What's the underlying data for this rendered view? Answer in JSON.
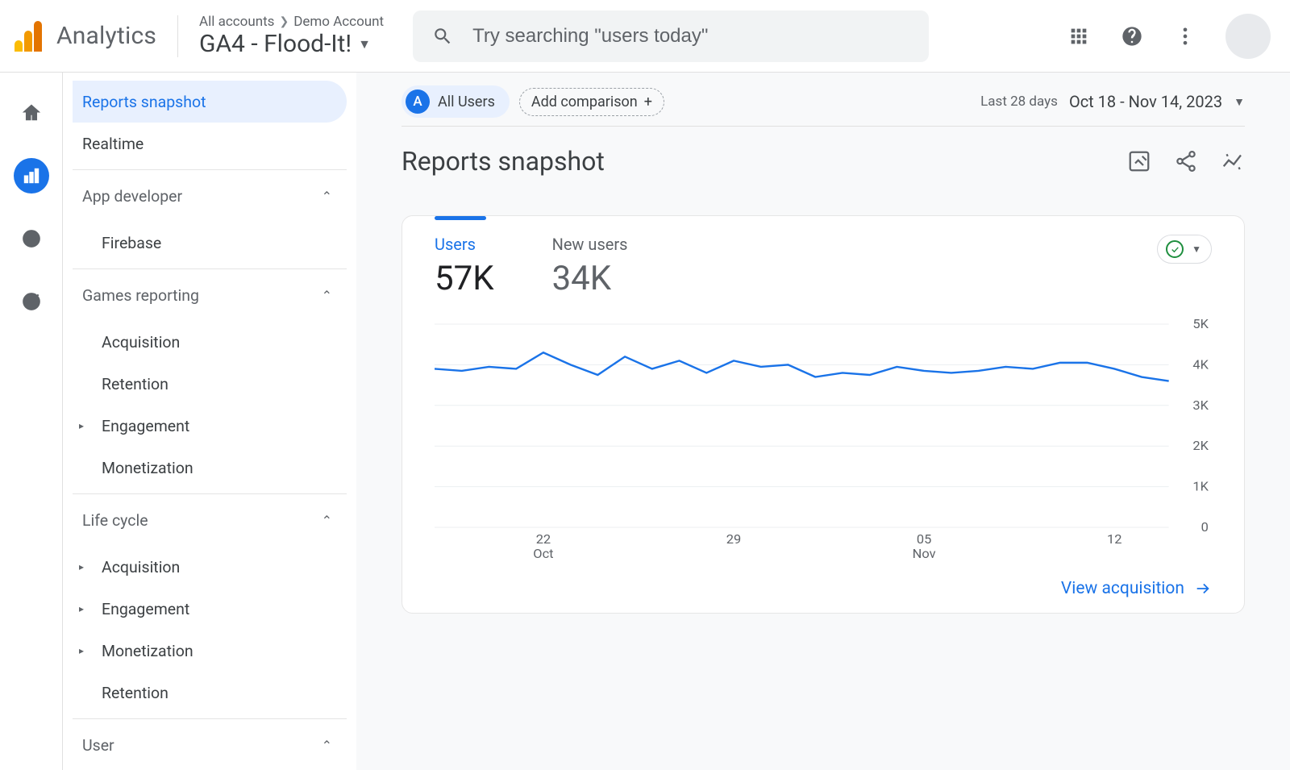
{
  "header": {
    "brand": "Analytics",
    "breadcrumb_root": "All accounts",
    "breadcrumb_account": "Demo Account",
    "property": "GA4 - Flood-It!",
    "search_placeholder": "Try searching \"users today\""
  },
  "rail": [
    {
      "name": "home-icon"
    },
    {
      "name": "reports-icon",
      "active": true
    },
    {
      "name": "explore-icon"
    },
    {
      "name": "advertising-icon"
    }
  ],
  "sidebar": {
    "top": [
      {
        "label": "Reports snapshot",
        "active": true
      },
      {
        "label": "Realtime"
      }
    ],
    "sections": [
      {
        "title": "App developer",
        "children": [
          {
            "label": "Firebase"
          }
        ]
      },
      {
        "title": "Games reporting",
        "children": [
          {
            "label": "Acquisition"
          },
          {
            "label": "Retention"
          },
          {
            "label": "Engagement",
            "expandable": true
          },
          {
            "label": "Monetization"
          }
        ]
      },
      {
        "title": "Life cycle",
        "children": [
          {
            "label": "Acquisition",
            "expandable": true
          },
          {
            "label": "Engagement",
            "expandable": true
          },
          {
            "label": "Monetization",
            "expandable": true
          },
          {
            "label": "Retention"
          }
        ]
      },
      {
        "title": "User",
        "children": []
      }
    ]
  },
  "segments": {
    "badge": "A",
    "label": "All Users",
    "add_label": "Add comparison"
  },
  "date": {
    "range_label": "Last 28 days",
    "range_text": "Oct 18 - Nov 14, 2023"
  },
  "page_title": "Reports snapshot",
  "card": {
    "metrics": [
      {
        "label": "Users",
        "value": "57K",
        "active": true
      },
      {
        "label": "New users",
        "value": "34K"
      }
    ],
    "view_link": "View acquisition"
  },
  "chart_data": {
    "type": "line",
    "title": "",
    "xlabel": "",
    "ylabel": "",
    "ylim": [
      0,
      5000
    ],
    "y_ticks": [
      "5K",
      "4K",
      "3K",
      "2K",
      "1K",
      "0"
    ],
    "x_ticks": [
      {
        "line1": "22",
        "line2": "Oct"
      },
      {
        "line1": "29",
        "line2": ""
      },
      {
        "line1": "05",
        "line2": "Nov"
      },
      {
        "line1": "12",
        "line2": ""
      }
    ],
    "x_dates": [
      "Oct 18",
      "Oct 19",
      "Oct 20",
      "Oct 21",
      "Oct 22",
      "Oct 23",
      "Oct 24",
      "Oct 25",
      "Oct 26",
      "Oct 27",
      "Oct 28",
      "Oct 29",
      "Oct 30",
      "Oct 31",
      "Nov 01",
      "Nov 02",
      "Nov 03",
      "Nov 04",
      "Nov 05",
      "Nov 06",
      "Nov 07",
      "Nov 08",
      "Nov 09",
      "Nov 10",
      "Nov 11",
      "Nov 12",
      "Nov 13",
      "Nov 14"
    ],
    "series": [
      {
        "name": "Users",
        "values": [
          3900,
          3850,
          3950,
          3900,
          4300,
          4000,
          3750,
          4200,
          3900,
          4100,
          3800,
          4100,
          3950,
          4000,
          3700,
          3800,
          3750,
          3950,
          3850,
          3800,
          3850,
          3950,
          3900,
          4050,
          4050,
          3900,
          3700,
          3600
        ]
      }
    ]
  }
}
